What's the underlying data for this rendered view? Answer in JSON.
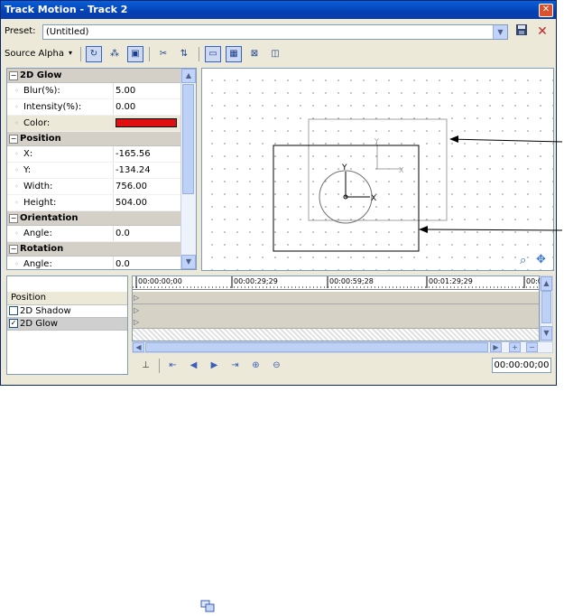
{
  "window": {
    "title": "Track Motion - Track 2",
    "close_glyph": "✕"
  },
  "preset": {
    "label": "Preset:",
    "value": "(Untitled)",
    "save_icon": "save-icon",
    "delete_icon": "delete-icon",
    "delete_glyph": "✕"
  },
  "toolbar": {
    "source_label": "Source Alpha",
    "dropdown_glyph": "▾"
  },
  "properties": {
    "glow": {
      "title": "2D Glow",
      "blur_label": "Blur(%):",
      "blur_value": "5.00",
      "intensity_label": "Intensity(%):",
      "intensity_value": "0.00",
      "color_label": "Color:",
      "color_value": "#e01010"
    },
    "position": {
      "title": "Position",
      "x_label": "X:",
      "x_value": "-165.56",
      "y_label": "Y:",
      "y_value": "-134.24",
      "width_label": "Width:",
      "width_value": "756.00",
      "height_label": "Height:",
      "height_value": "504.00"
    },
    "orientation": {
      "title": "Orientation",
      "angle_label": "Angle:",
      "angle_value": "0.0"
    },
    "rotation": {
      "title": "Rotation",
      "angle_label": "Angle:",
      "angle_value": "0.0"
    }
  },
  "canvas": {
    "axis_x": "X",
    "axis_y": "Y"
  },
  "tracks": {
    "header": "Position",
    "items": [
      {
        "label": "2D Shadow",
        "checked": ""
      },
      {
        "label": "2D Glow",
        "checked": "✓"
      }
    ]
  },
  "timeline": {
    "ticks": [
      "00:00:00;00",
      "00:00:29;29",
      "00:00:59;28",
      "00:01:29;29",
      "00:0"
    ],
    "timecode": "00:00:00;00"
  },
  "colors": {
    "titlebar": "#0a46b8",
    "glow_color": "#e01010"
  }
}
